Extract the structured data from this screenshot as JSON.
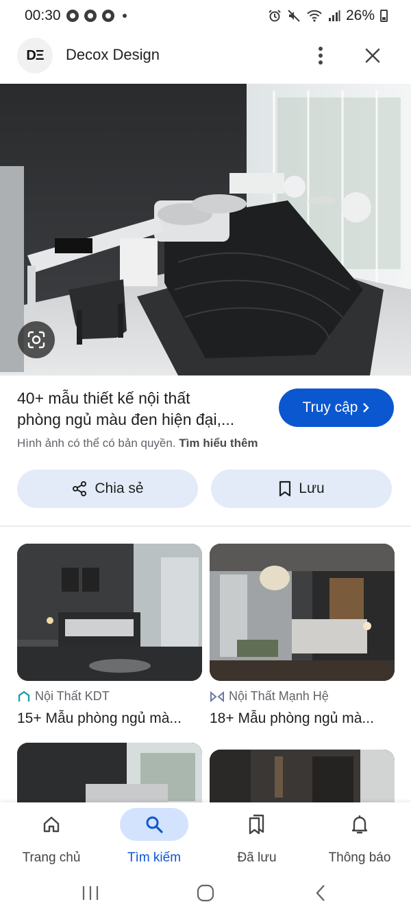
{
  "status_bar": {
    "time": "00:30",
    "battery": "26%"
  },
  "header": {
    "logo_text": "DΞ",
    "site_name": "Decox Design"
  },
  "result": {
    "title_line1": "40+ mẫu thiết kế nội thất",
    "title_line2": "phòng ngủ màu đen hiện đại,...",
    "visit_label": "Truy cập",
    "copyright_text": "Hình ảnh có thể có bản quyền.",
    "learn_more": "Tìm hiểu thêm",
    "share_label": "Chia sẻ",
    "save_label": "Lưu"
  },
  "related": [
    {
      "source": "Nội Thất KDT",
      "title": "15+ Mẫu phòng ngủ mà..."
    },
    {
      "source": "Nội Thất Mạnh Hệ",
      "title": "18+ Mẫu phòng ngủ mà..."
    }
  ],
  "bottom_nav": {
    "items": [
      {
        "label": "Trang chủ",
        "icon": "home-icon"
      },
      {
        "label": "Tìm kiếm",
        "icon": "search-icon",
        "active": true
      },
      {
        "label": "Đã lưu",
        "icon": "bookmarks-icon"
      },
      {
        "label": "Thông báo",
        "icon": "bell-icon"
      }
    ]
  },
  "colors": {
    "accent": "#0b57d0",
    "pill_bg": "#e3ebf8",
    "active_nav_bg": "#d3e3fd"
  }
}
